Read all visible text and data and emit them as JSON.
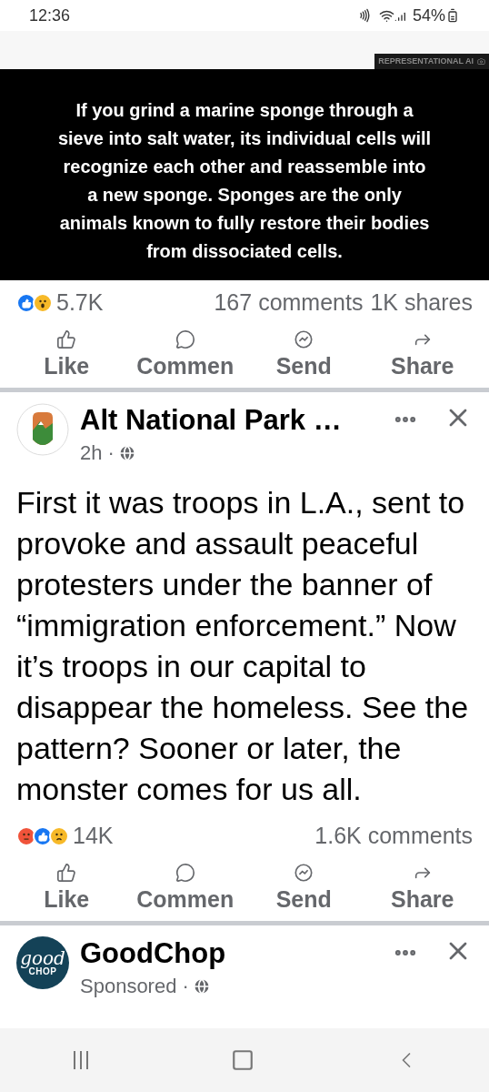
{
  "status_bar": {
    "time": "12:36",
    "battery": "54%"
  },
  "posts": [
    {
      "kind": "image",
      "image": {
        "badge": "REPRESENTATIONAL AI",
        "caption": "If you grind a marine sponge through a sieve into salt water, its individual cells will recognize each other and reassemble into a new sponge. Sponges are the only animals known to fully restore their bodies from dissociated cells."
      },
      "reactions": [
        {
          "kind": "like"
        },
        {
          "kind": "wow"
        }
      ],
      "reaction_count": "5.7K",
      "comments": "167 comments",
      "shares": "1K shares",
      "actions": [
        "Like",
        "Commen",
        "Send",
        "Share"
      ]
    },
    {
      "kind": "text",
      "author": "Alt National Park …",
      "meta": "2h ·",
      "text": "First it was troops in L.A., sent to provoke and assault peaceful protesters under the banner of “immigration enforcement.” Now it’s troops in our capital to disappear the homeless. See the pattern? Sooner or later, the monster comes for us all.",
      "reactions": [
        {
          "kind": "angry"
        },
        {
          "kind": "like"
        },
        {
          "kind": "sad"
        }
      ],
      "reaction_count": "14K",
      "comments": "1.6K comments",
      "actions": [
        "Like",
        "Commen",
        "Send",
        "Share"
      ]
    },
    {
      "kind": "header",
      "author": "GoodChop",
      "logo": [
        "good",
        "CHOP"
      ],
      "meta": "Sponsored ·"
    }
  ]
}
